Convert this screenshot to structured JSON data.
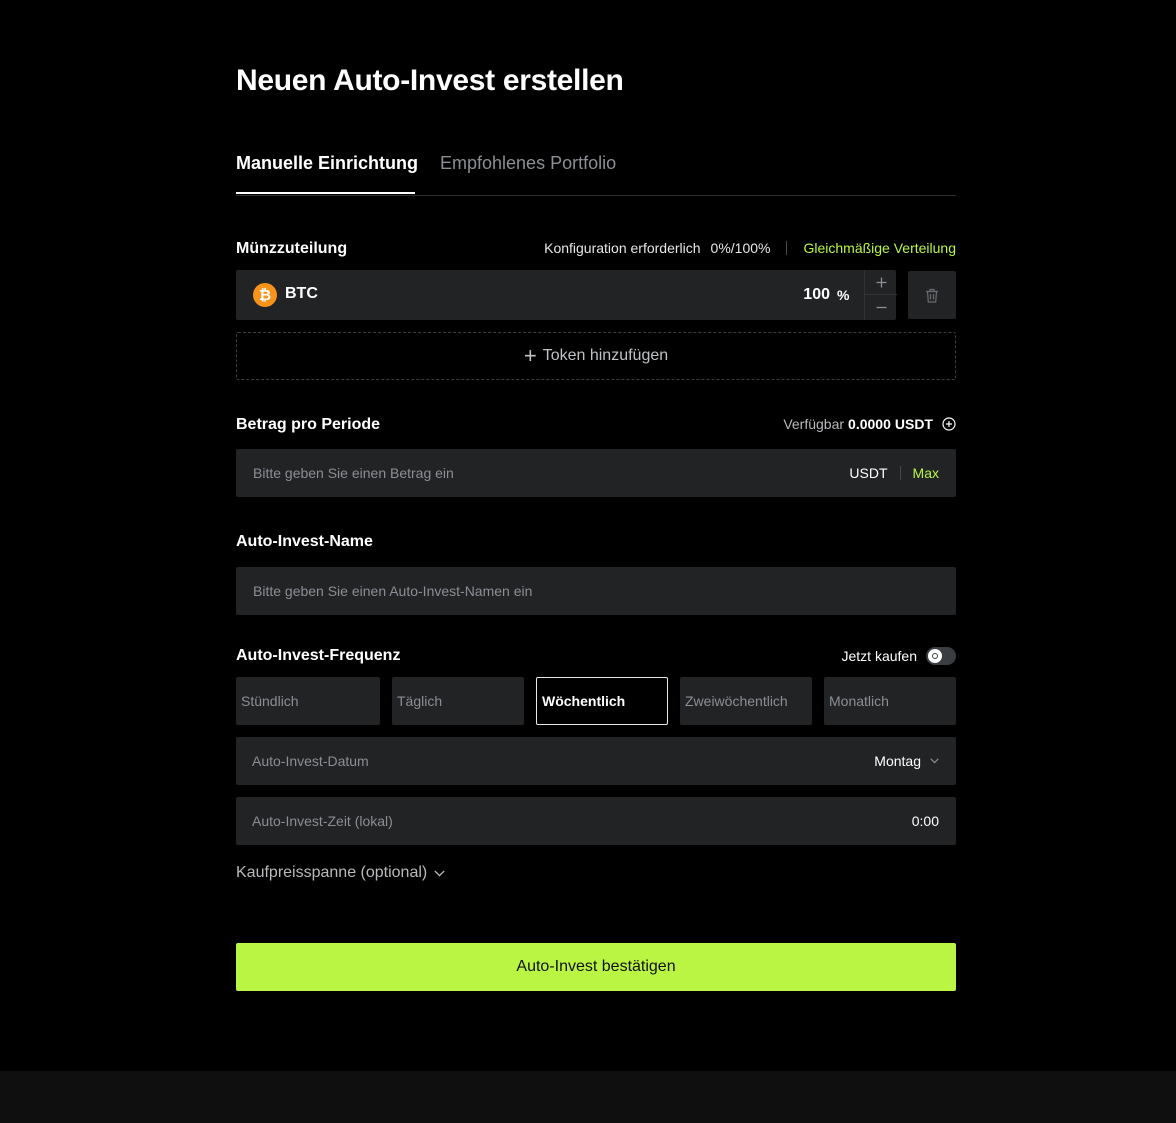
{
  "page": {
    "title": "Neuen Auto-Invest erstellen"
  },
  "tabs": [
    {
      "label": "Manuelle Einrichtung",
      "active": true
    },
    {
      "label": "Empfohlenes Portfolio",
      "active": false
    }
  ],
  "allocation": {
    "label": "Münzzuteilung",
    "config_required": "Konfiguration erforderlich",
    "progress": "0%/100%",
    "even_distribution": "Gleichmäßige Verteilung",
    "coins": [
      {
        "icon": "bitcoin-icon",
        "symbol_glyph": "₿",
        "name": "BTC",
        "percent": "100",
        "unit": "%"
      }
    ],
    "add_token": "Token hinzufügen"
  },
  "amount": {
    "label": "Betrag pro Periode",
    "available_label": "Verfügbar",
    "available_value": "0.0000",
    "available_unit": "USDT",
    "placeholder": "Bitte geben Sie einen Betrag ein",
    "currency": "USDT",
    "max": "Max"
  },
  "name": {
    "label": "Auto-Invest-Name",
    "placeholder": "Bitte geben Sie einen Auto-Invest-Namen ein"
  },
  "frequency": {
    "label": "Auto-Invest-Frequenz",
    "buy_now": "Jetzt kaufen",
    "buy_now_enabled": false,
    "options": [
      {
        "label": "Stündlich",
        "active": false
      },
      {
        "label": "Täglich",
        "active": false
      },
      {
        "label": "Wöchentlich",
        "active": true
      },
      {
        "label": "Zweiwöchentlich",
        "active": false
      },
      {
        "label": "Monatlich",
        "active": false
      }
    ],
    "date_label": "Auto-Invest-Datum",
    "date_value": "Montag",
    "time_label": "Auto-Invest-Zeit (lokal)",
    "time_value": "0:00"
  },
  "price_range": {
    "label": "Kaufpreisspanne (optional)"
  },
  "confirm_button": "Auto-Invest bestätigen",
  "colors": {
    "accent": "#b9f542",
    "background": "#000000",
    "field": "#212325",
    "bitcoin": "#f7931a"
  }
}
